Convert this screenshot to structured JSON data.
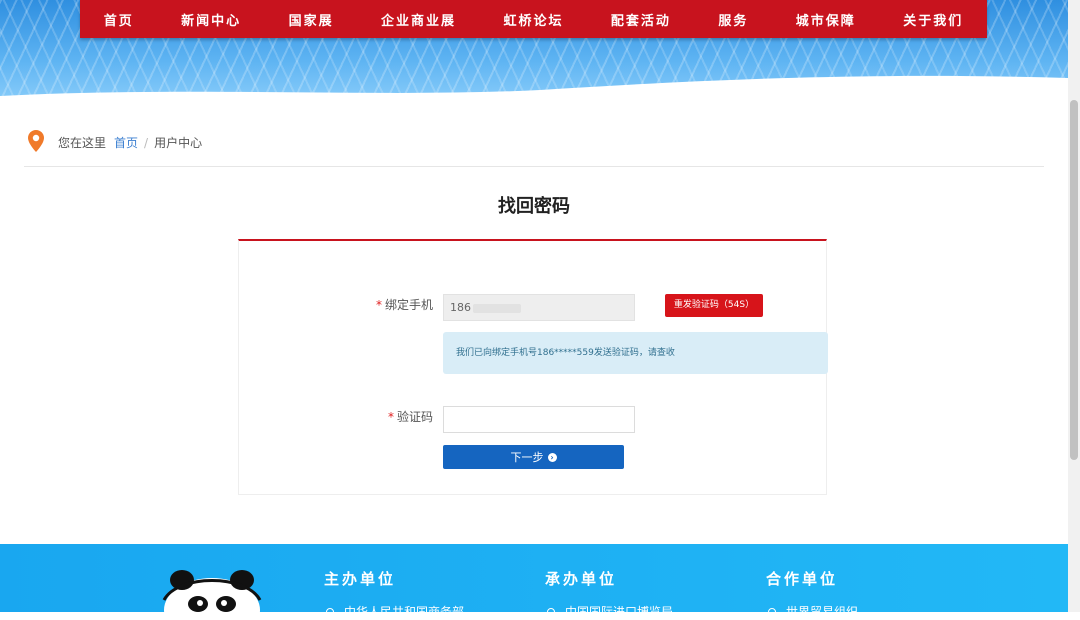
{
  "nav": {
    "items": [
      "首页",
      "新闻中心",
      "国家展",
      "企业商业展",
      "虹桥论坛",
      "配套活动",
      "服务",
      "城市保障",
      "关于我们"
    ]
  },
  "breadcrumb": {
    "prefix": "您在这里",
    "home": "首页",
    "current": "用户中心"
  },
  "page": {
    "title": "找回密码"
  },
  "form": {
    "phone_label": "绑定手机",
    "phone_value": "186",
    "resend_label": "重发验证码（54S）",
    "notice": "我们已向绑定手机号186*****559发送验证码，请查收",
    "code_label": "验证码",
    "code_value": "",
    "next_label": "下一步"
  },
  "footer": {
    "columns": [
      {
        "title": "主办单位",
        "item": "中华人民共和国商务部"
      },
      {
        "title": "承办单位",
        "item": "中国国际进口博览局"
      },
      {
        "title": "合作单位",
        "item": "世界贸易组织"
      }
    ]
  },
  "colors": {
    "nav_bg": "#c8131e",
    "accent_red": "#d7141a",
    "primary_blue": "#1565c0",
    "notice_bg": "#d9edf7",
    "footer_bg": "#1fb0f3"
  },
  "icons": {
    "location": "map-pin-icon",
    "next": "circle-arrow-right-icon",
    "list_bullet": "ring-bullet-icon"
  }
}
